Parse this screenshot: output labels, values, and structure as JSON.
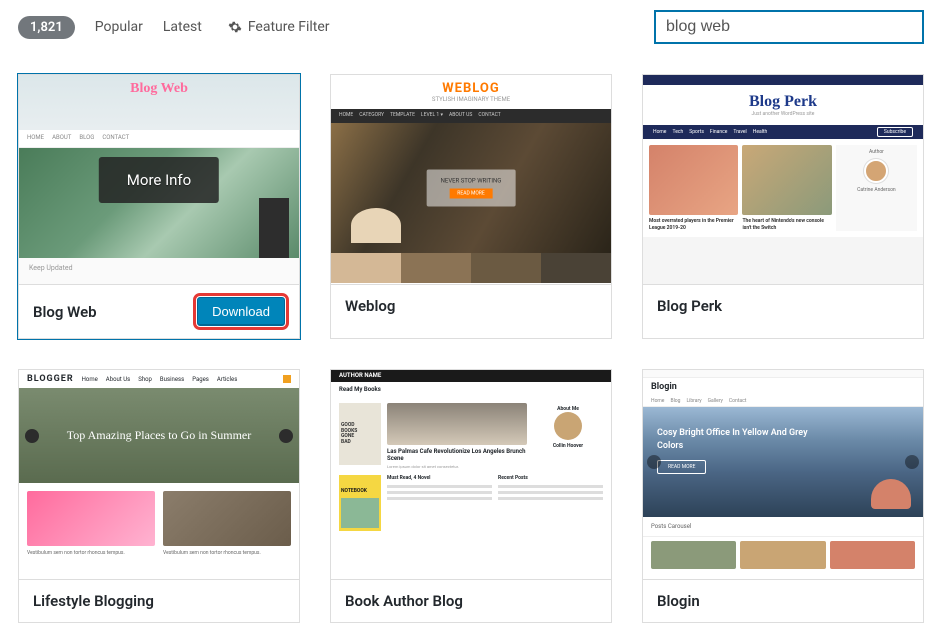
{
  "topbar": {
    "count": "1,821",
    "filters": [
      "Popular",
      "Latest"
    ],
    "feature_filter": "Feature Filter",
    "search_value": "blog web"
  },
  "themes": [
    {
      "name": "Blog Web",
      "highlighted": true,
      "overlay": "More Info",
      "show_download": true,
      "download_label": "Download",
      "thumb_key": "t1",
      "thumb": {
        "logo": "Blog Web",
        "footer": "Keep Updated"
      }
    },
    {
      "name": "Weblog",
      "thumb_key": "t2",
      "thumb": {
        "brand": "WEBLOG",
        "sub": "STYLISH IMAGINARY THEME",
        "badge": "NEVER STOP WRITING",
        "nav": [
          "HOME",
          "CATEGORY",
          "TEMPLATE",
          "LEVEL 1 ▾",
          "ABOUT US",
          "CONTACT"
        ]
      }
    },
    {
      "name": "Blog Perk",
      "thumb_key": "t3",
      "thumb": {
        "brand": "Blog Perk",
        "sub": "Just another WordPress site",
        "nav": [
          "Home",
          "Tech",
          "Sports",
          "Finance",
          "Travel",
          "Health"
        ],
        "subscribe": "Subscribe",
        "card1": "Most overrated players in the Premier League 2019-20",
        "card2": "The heart of Nintendo's new console isn't the Switch",
        "author": "Author",
        "author_name": "Catrine Anderson"
      }
    },
    {
      "name": "Lifestyle Blogging",
      "thumb_key": "t4",
      "thumb": {
        "logo": "BLOGGER",
        "nav": [
          "Home",
          "About Us",
          "Shop",
          "Business",
          "Pages",
          "Articles"
        ],
        "hero": "Top Amazing Places to Go in Summer",
        "card_txt": "Vestibulum sem non tortor rhoncus tempus."
      }
    },
    {
      "name": "Book Author Blog",
      "thumb_key": "t5",
      "thumb": {
        "author": "AUTHOR NAME",
        "read": "Read My Books",
        "book1a": "GOOD",
        "book1b": "BOOKS",
        "book1c": "GONE",
        "book1d": "BAD",
        "title": "Las Palmas Cafe Revolutionize Los Angeles Brunch Scene",
        "about": "About Me",
        "author_name": "Collin Hoover",
        "nb": "NOTEBOOK",
        "must": "Must Read, 4 Novel",
        "recent": "Recent Posts"
      }
    },
    {
      "name": "Blogin",
      "thumb_key": "t6",
      "thumb": {
        "brand": "Blogin",
        "nav": [
          "Home",
          "Blog",
          "Library",
          "Gallery",
          "Contact"
        ],
        "hero": "Cosy Bright Office In Yellow And Grey Colors",
        "btn": "READ MORE",
        "sub": "Posts Carousel"
      }
    }
  ]
}
